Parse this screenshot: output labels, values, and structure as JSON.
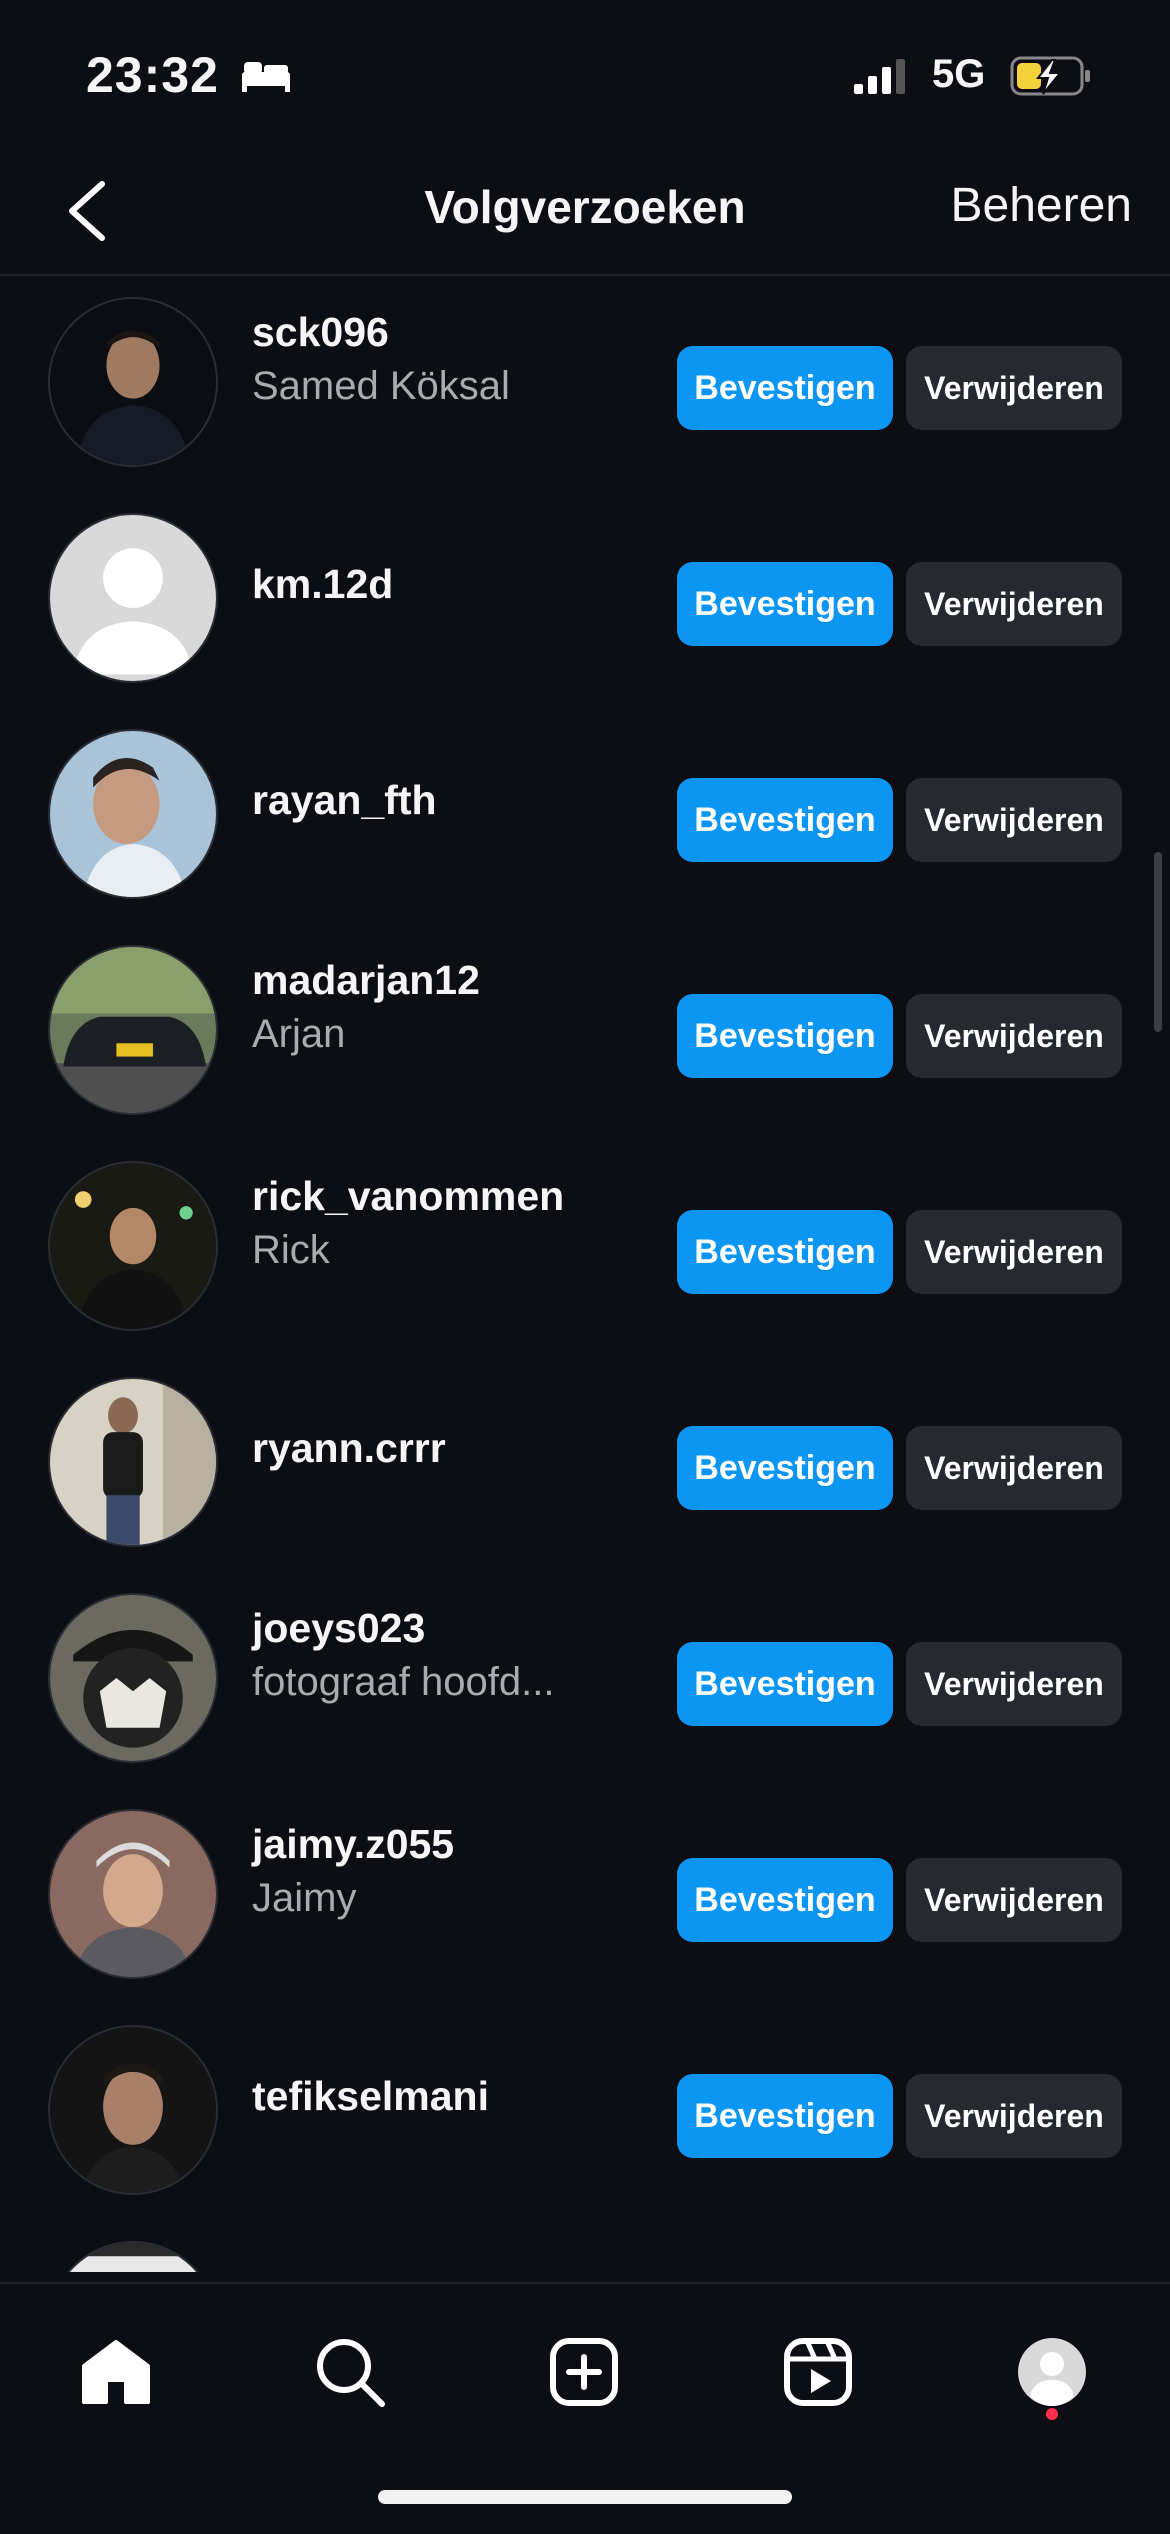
{
  "status_bar": {
    "time": "23:32",
    "network": "5G",
    "signal_icon": "cellular-signal-icon",
    "battery_icon": "battery-charging-icon",
    "focus_icon": "sleep-bed-icon"
  },
  "header": {
    "title": "Volgverzoeken",
    "manage_label": "Beheren",
    "back_icon": "chevron-left-icon"
  },
  "buttons": {
    "confirm_label": "Bevestigen",
    "delete_label": "Verwijderen"
  },
  "requests": [
    {
      "username": "sck096",
      "full_name": "Samed Köksal"
    },
    {
      "username": "km.12d",
      "full_name": ""
    },
    {
      "username": "rayan_fth",
      "full_name": ""
    },
    {
      "username": "madarjan12",
      "full_name": "Arjan"
    },
    {
      "username": "rick_vanommen",
      "full_name": "Rick"
    },
    {
      "username": "ryann.crrr",
      "full_name": ""
    },
    {
      "username": "joeys023",
      "full_name": "fotograaf hoofd..."
    },
    {
      "username": "jaimy.z055",
      "full_name": "Jaimy"
    },
    {
      "username": "tefikselmani",
      "full_name": ""
    }
  ],
  "tab_bar": [
    {
      "icon": "home-icon"
    },
    {
      "icon": "search-icon"
    },
    {
      "icon": "create-post-icon"
    },
    {
      "icon": "reels-icon"
    },
    {
      "icon": "profile-avatar-icon"
    }
  ],
  "colors": {
    "background": "#0c0e14",
    "accent": "#0d95f4",
    "secondary_button": "#262930",
    "notification": "#ff2e4c"
  }
}
